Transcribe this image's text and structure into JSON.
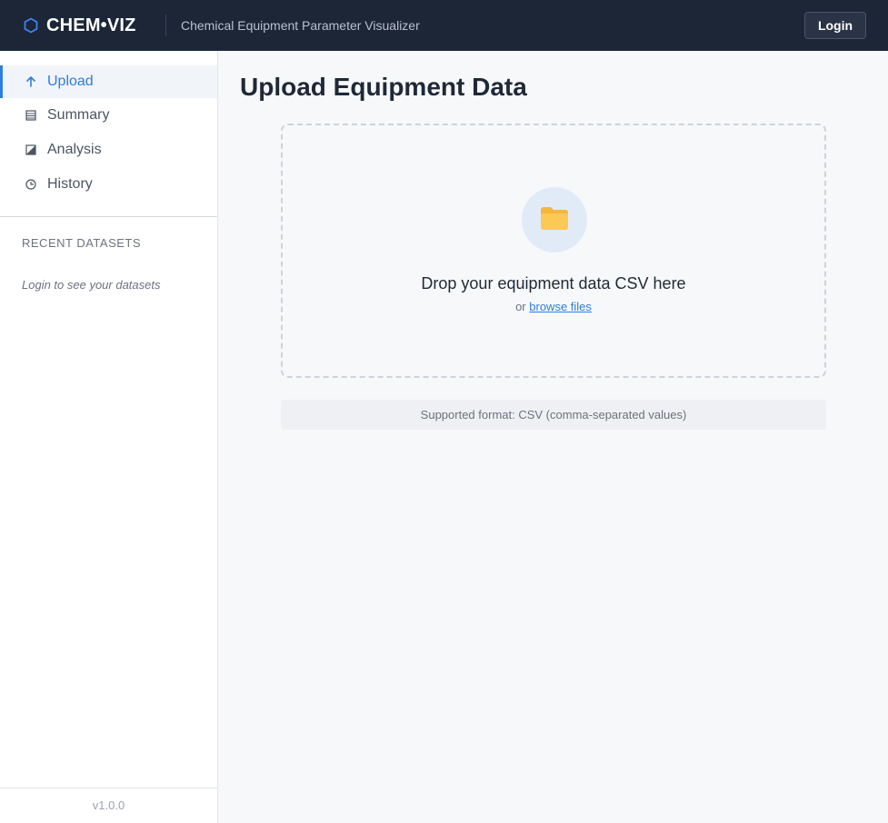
{
  "header": {
    "brand_icon": "hexagon-icon",
    "brand_name": "CHEM•VIZ",
    "subtitle": "Chemical Equipment Parameter Visualizer",
    "login_label": "Login",
    "accent_color": "#2f7de1",
    "bar_color": "#1c2637"
  },
  "sidebar": {
    "items": [
      {
        "label": "Upload",
        "icon": "arrow-up-icon",
        "active": true
      },
      {
        "label": "Summary",
        "icon": "list-icon",
        "active": false
      },
      {
        "label": "Analysis",
        "icon": "chart-icon",
        "active": false
      },
      {
        "label": "History",
        "icon": "clock-icon",
        "active": false
      }
    ],
    "recent_heading": "RECENT DATASETS",
    "recent_empty": "Login to see your datasets",
    "version": "v1.0.0"
  },
  "main": {
    "title": "Upload Equipment Data",
    "dropzone": {
      "icon": "folder-icon",
      "title": "Drop your equipment data CSV here",
      "or_text": "or",
      "browse_label": "browse files"
    },
    "format_note": "Supported format: CSV (comma-separated values)"
  }
}
